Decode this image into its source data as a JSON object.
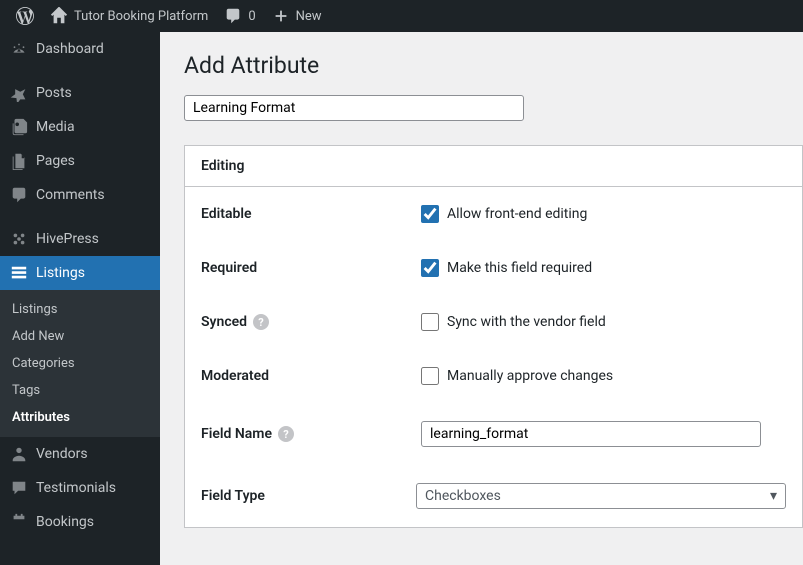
{
  "topbar": {
    "site_name": "Tutor Booking Platform",
    "comment_count": "0",
    "new_label": "New"
  },
  "sidebar": {
    "items": [
      {
        "label": "Dashboard",
        "icon": "dashboard"
      },
      {
        "label": "Posts",
        "icon": "pin"
      },
      {
        "label": "Media",
        "icon": "media"
      },
      {
        "label": "Pages",
        "icon": "pages"
      },
      {
        "label": "Comments",
        "icon": "comment"
      },
      {
        "label": "HivePress",
        "icon": "hivepress"
      },
      {
        "label": "Listings",
        "icon": "listings",
        "active": true
      },
      {
        "label": "Vendors",
        "icon": "vendors"
      },
      {
        "label": "Testimonials",
        "icon": "testimonials"
      },
      {
        "label": "Bookings",
        "icon": "bookings"
      }
    ],
    "submenu": [
      {
        "label": "Listings"
      },
      {
        "label": "Add New"
      },
      {
        "label": "Categories"
      },
      {
        "label": "Tags"
      },
      {
        "label": "Attributes",
        "current": true
      }
    ]
  },
  "page": {
    "title": "Add Attribute",
    "attribute_title": "Learning Format"
  },
  "panel": {
    "header": "Editing",
    "rows": {
      "editable": {
        "label": "Editable",
        "checkbox_label": "Allow front-end editing",
        "checked": true
      },
      "required": {
        "label": "Required",
        "checkbox_label": "Make this field required",
        "checked": true
      },
      "synced": {
        "label": "Synced",
        "checkbox_label": "Sync with the vendor field",
        "checked": false,
        "help": true
      },
      "moderated": {
        "label": "Moderated",
        "checkbox_label": "Manually approve changes",
        "checked": false
      },
      "field_name": {
        "label": "Field Name",
        "value": "learning_format",
        "help": true
      },
      "field_type": {
        "label": "Field Type",
        "value": "Checkboxes"
      }
    }
  }
}
